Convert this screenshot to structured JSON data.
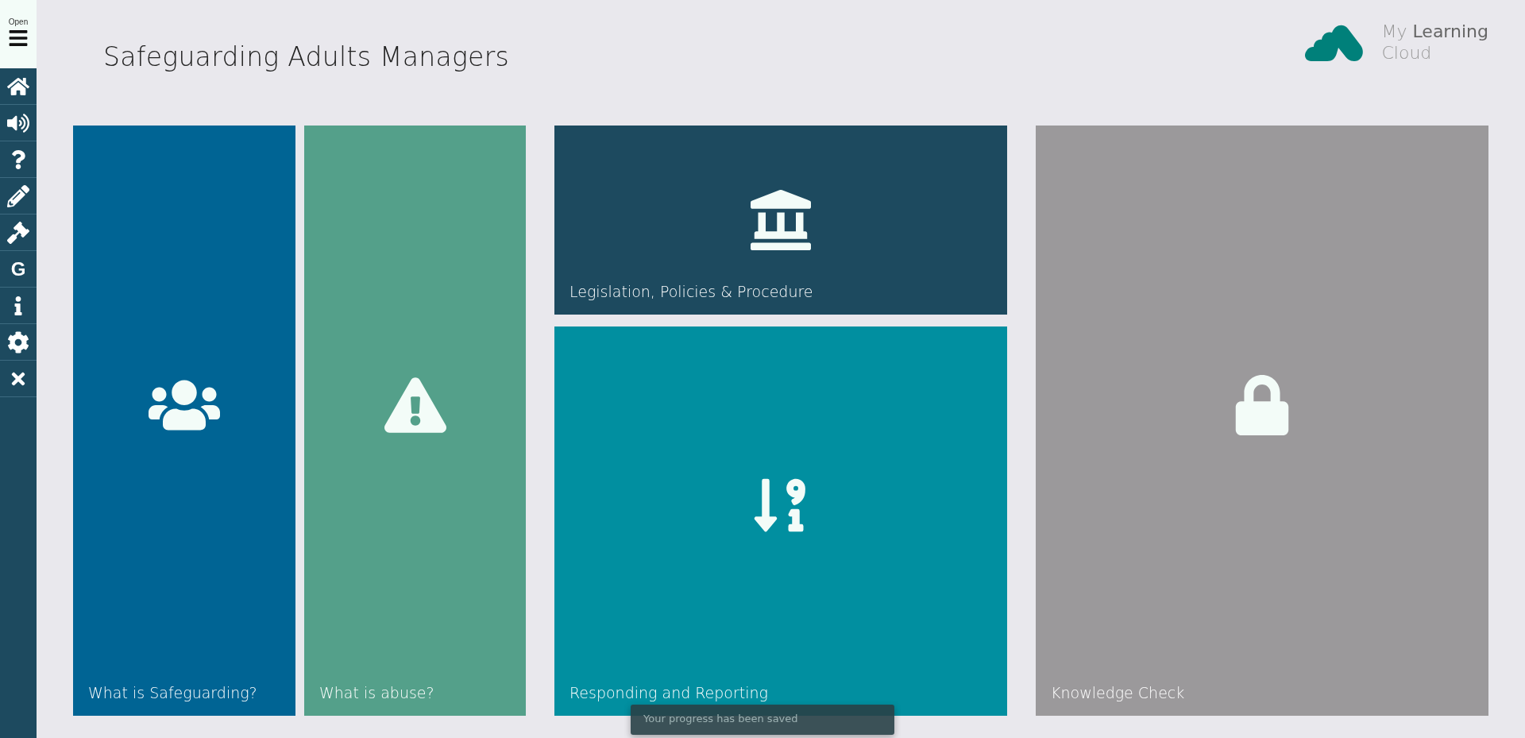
{
  "sidebar": {
    "toggle_label": "Open",
    "items": [
      {
        "kind": "home"
      },
      {
        "kind": "audio"
      },
      {
        "kind": "help"
      },
      {
        "kind": "notes"
      },
      {
        "kind": "legal"
      },
      {
        "kind": "letter",
        "label": "G"
      },
      {
        "kind": "info"
      },
      {
        "kind": "settings"
      },
      {
        "kind": "close"
      }
    ]
  },
  "header": {
    "title": "Safeguarding Adults Managers",
    "logo": "My **Learning**",
    "logo_line_2": "Cloud"
  },
  "tiles": [
    {
      "label": "What is Safeguarding?",
      "kind": "people",
      "color": "#006494",
      "locked": false
    },
    {
      "label": "What is abuse?",
      "kind": "warning",
      "color": "#54a08a",
      "locked": false
    },
    {
      "label": "Legislation, Policies & Procedure",
      "kind": "building",
      "color": "#1d4a5f",
      "locked": false
    },
    {
      "label": "Responding and Reporting",
      "kind": "sort",
      "color": "#018fa0",
      "locked": false
    },
    {
      "label": "Knowledge Check",
      "color": "#9b999b",
      "locked": true
    }
  ],
  "toast": "Your progress has been saved"
}
